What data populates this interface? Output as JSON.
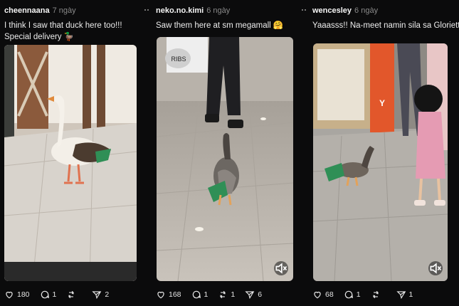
{
  "posts": [
    {
      "username": "cheennaana",
      "time": "7 ngày",
      "caption": "I think I saw that duck here too!!! Special delivery 🦆",
      "likes": "180",
      "comments": "1",
      "reposts": "",
      "shares": "2"
    },
    {
      "username": "neko.no.kimi",
      "time": "6 ngày",
      "caption": "Saw them here at sm megamall 🤗",
      "likes": "168",
      "comments": "1",
      "reposts": "1",
      "shares": "6"
    },
    {
      "username": "wencesley",
      "time": "6 ngày",
      "caption": "Yaaasss!! Na-meet namin sila sa Glorietta Masunurin yung duck 🦆💕",
      "likes": "68",
      "comments": "1",
      "reposts": "",
      "shares": "1"
    }
  ],
  "media": {
    "bag_text": "RIBS",
    "store_text": "Y"
  },
  "icons": {
    "like": "heart-icon",
    "comment": "comment-icon",
    "repost": "repost-icon",
    "share": "send-icon",
    "mute": "speaker-muted-icon",
    "more": "more-dots-icon"
  },
  "colors": {
    "background": "#0b0b0c",
    "muted_text": "#8a8a8a",
    "bag_green": "#2f8f56"
  }
}
